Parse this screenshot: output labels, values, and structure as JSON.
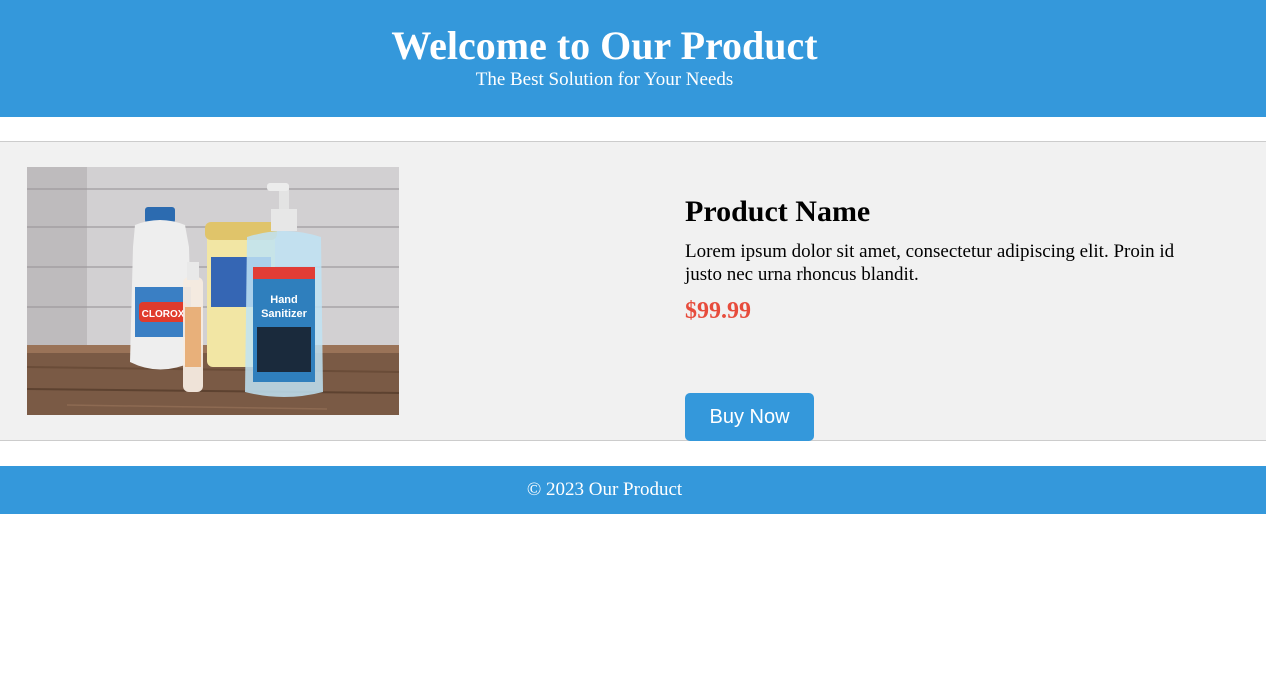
{
  "header": {
    "title": "Welcome to Our Product",
    "subtitle": "The Best Solution for Your Needs",
    "background_color": "#3498db"
  },
  "product": {
    "image_description": "product-photo-cleaning-supplies",
    "name": "Product Name",
    "description": "Lorem ipsum dolor sit amet, consectetur adipiscing elit. Proin id justo nec urna rhoncus blandit.",
    "price": "$99.99",
    "price_color": "#e74c3c",
    "buy_label": "Buy Now"
  },
  "footer": {
    "text": "© 2023 Our Product"
  }
}
